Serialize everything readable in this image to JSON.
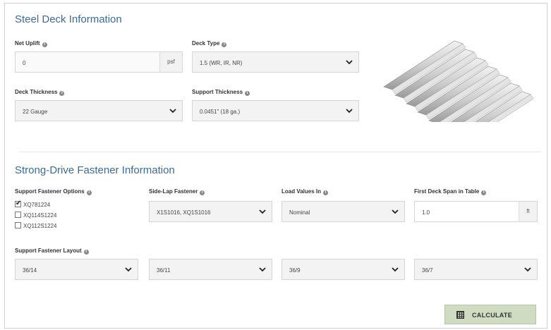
{
  "steel_deck": {
    "title": "Steel Deck Information",
    "net_uplift": {
      "label": "Net Uplift",
      "value": "0",
      "unit": "psf"
    },
    "deck_type": {
      "label": "Deck Type",
      "value": "1.5 (WR, IR, NR)"
    },
    "deck_thickness": {
      "label": "Deck Thickness",
      "value": "22 Gauge"
    },
    "support_thickness": {
      "label": "Support Thickness",
      "value": "0.0451\" (18 ga.)"
    },
    "image_icon": "corrugated-steel-deck-image"
  },
  "fastener": {
    "title": "Strong-Drive Fastener Information",
    "support_options": {
      "label": "Support Fastener Options",
      "items": [
        {
          "label": "XQ781224",
          "checked": true
        },
        {
          "label": "XQ114S1224",
          "checked": false
        },
        {
          "label": "XQ112S1224",
          "checked": false
        }
      ]
    },
    "side_lap": {
      "label": "Side-Lap Fastener",
      "value": "X1S1016, XQ1S1016"
    },
    "load_values": {
      "label": "Load Values In",
      "value": "Nominal"
    },
    "first_span": {
      "label": "First Deck Span in Table",
      "value": "1.0",
      "unit": "ft"
    },
    "layout": {
      "label": "Support Fastener Layout",
      "values": [
        "36/14",
        "36/11",
        "36/9",
        "36/7"
      ]
    }
  },
  "actions": {
    "calculate_label": "CALCULATE",
    "calculate_icon": "calculator-icon"
  },
  "colors": {
    "title": "#3b6b98",
    "button_bg": "#cfdcc2"
  }
}
